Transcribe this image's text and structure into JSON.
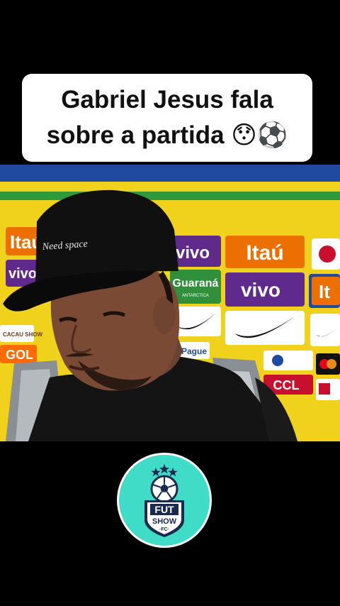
{
  "caption": {
    "line1": "Gabriel Jesus fala",
    "line2_text": "sobre a partida",
    "line2_emojis": "😯⚽"
  },
  "backdrop": {
    "sponsor_itau": "Itaú",
    "sponsor_vivo": "vivo",
    "sponsor_guarana": "Guaraná",
    "sponsor_guarana_sub": "ANTARCTICA",
    "sponsor_gol": "GOL",
    "sponsor_cacau": "CACAU SHOW",
    "sponsor_ccl": "CCL",
    "sponsor_pague": "Pague",
    "cap_text": "Need space"
  },
  "logo": {
    "line1": "FUT",
    "line2": "SHOW",
    "line3": "·FC·"
  },
  "colors": {
    "background": "#000000",
    "caption_bg": "#ffffff",
    "backdrop_yellow": "#f0d21c",
    "stripe_blue": "#1f4aa0",
    "stripe_green": "#2d9a3c",
    "logo_teal": "#3fdcc8",
    "logo_navy": "#1a2a4e"
  }
}
